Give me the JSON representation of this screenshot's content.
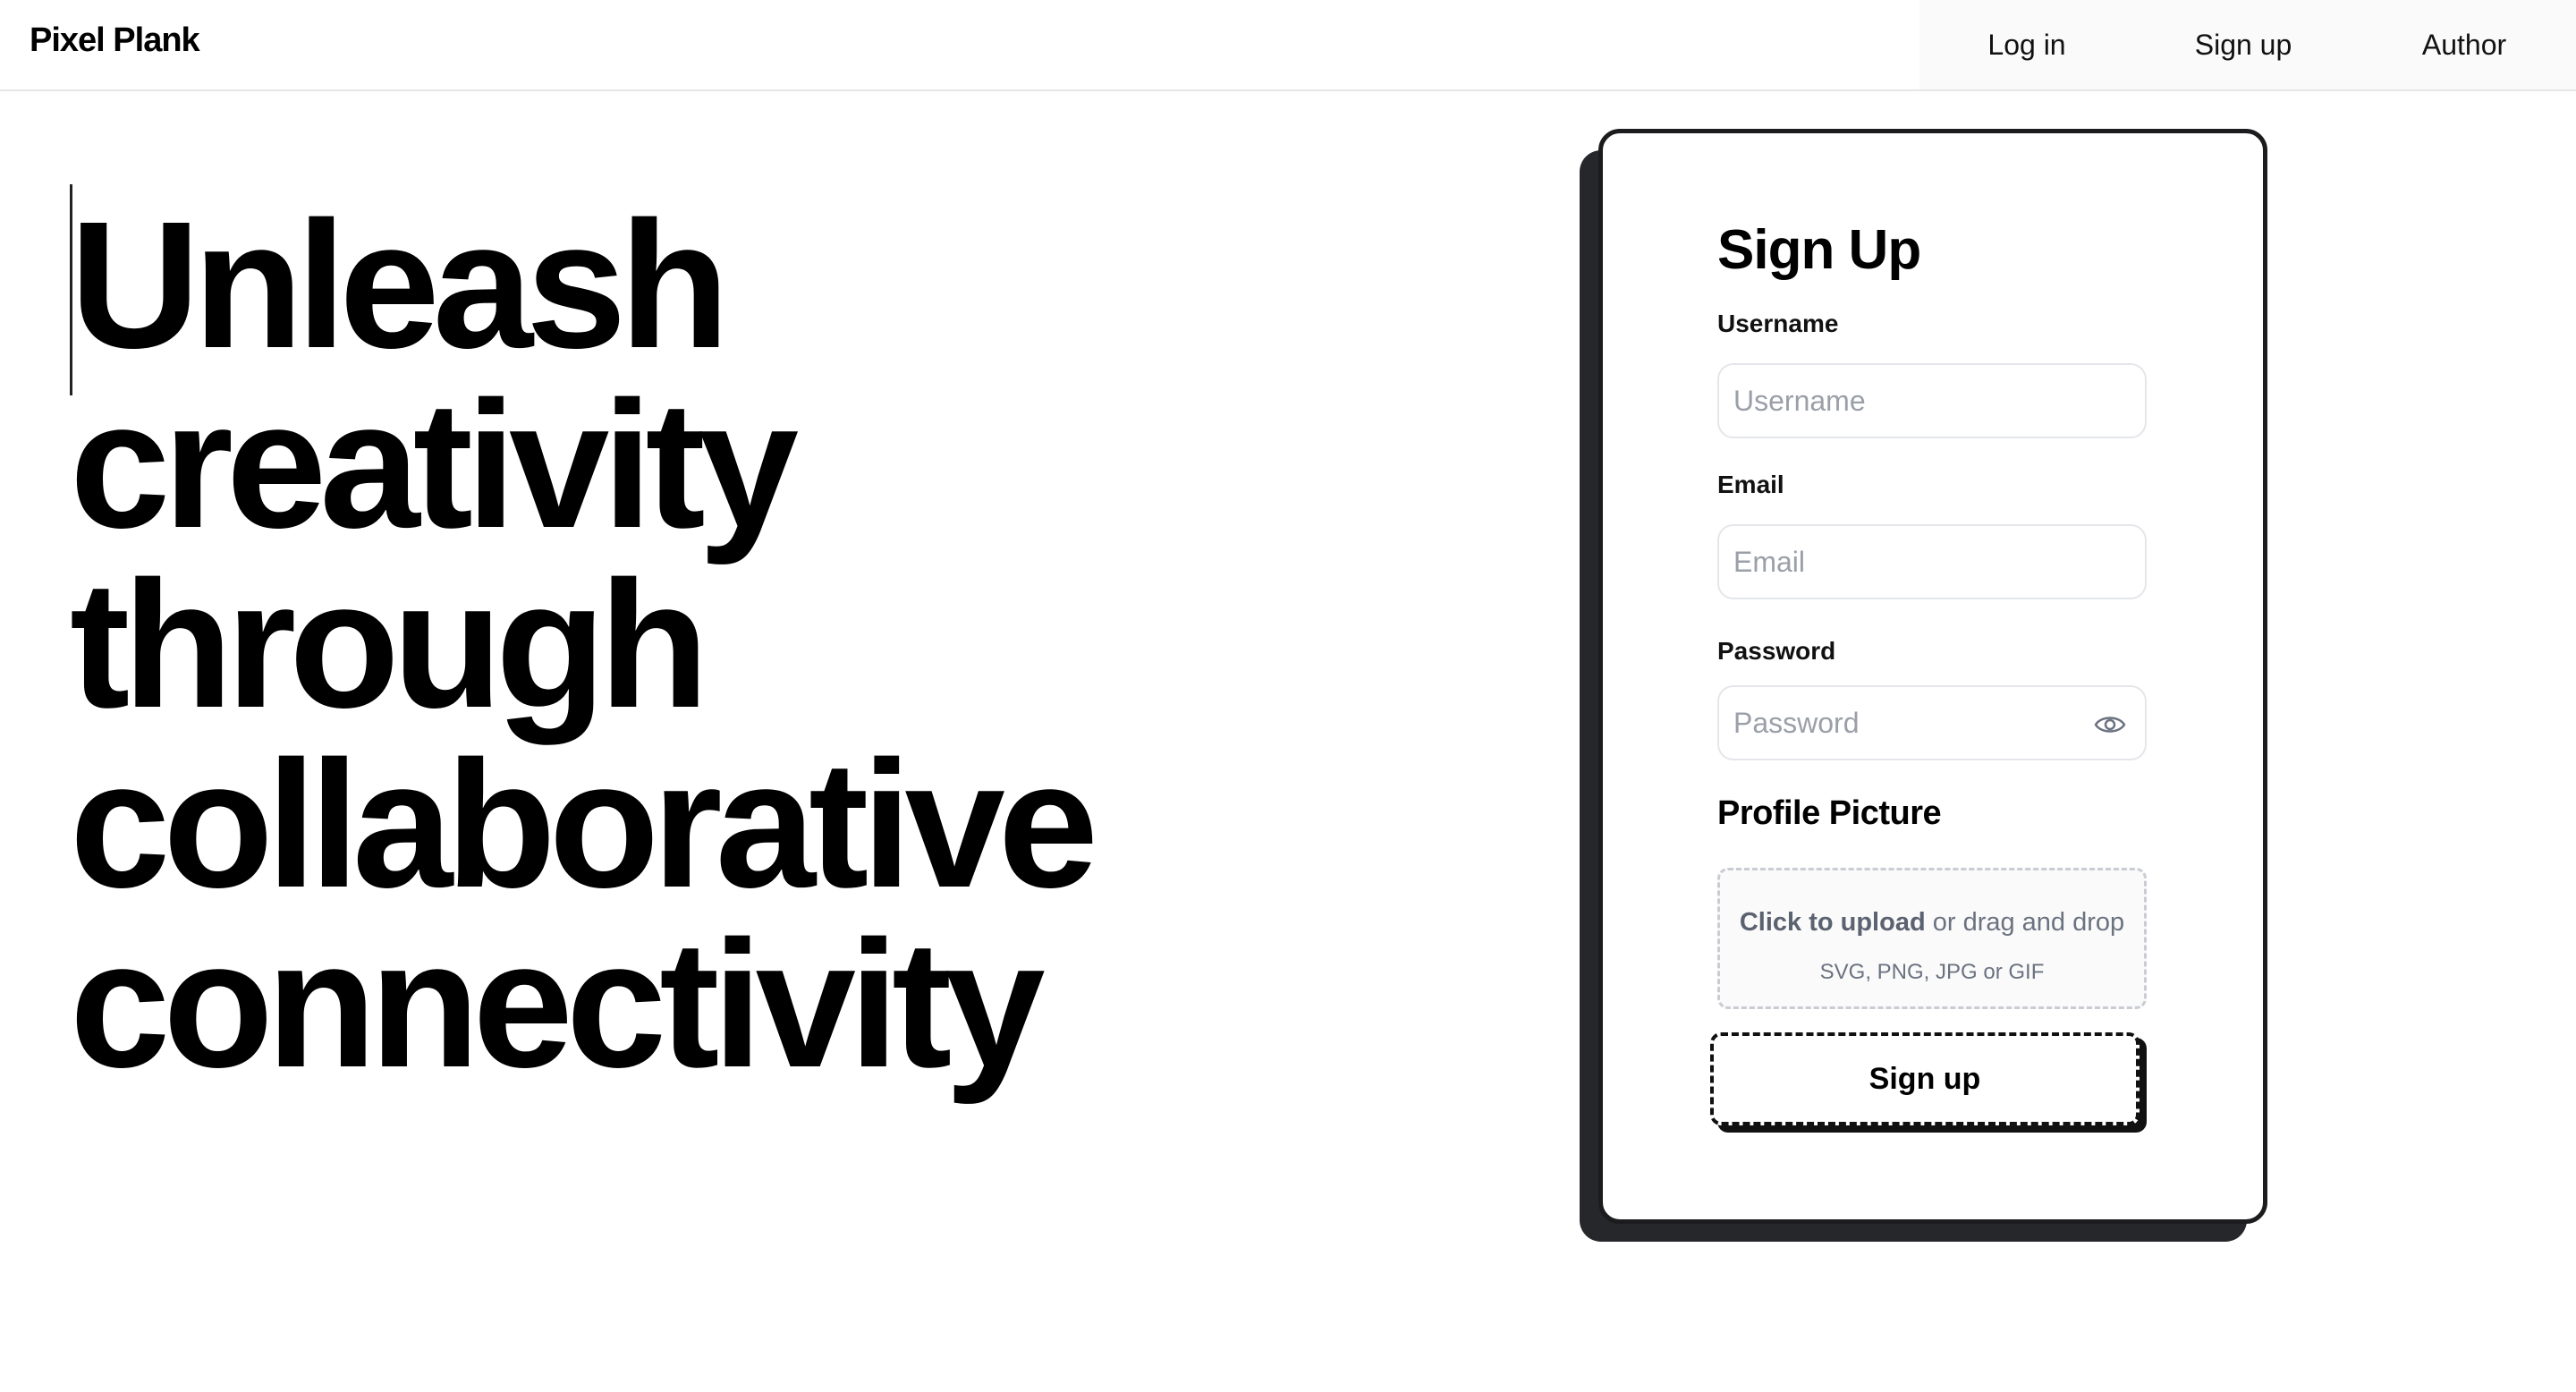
{
  "header": {
    "brand": "Pixel Plank",
    "nav": {
      "login": "Log in",
      "signup": "Sign up",
      "author": "Author"
    }
  },
  "hero": {
    "lines": [
      "Unleash",
      "creativity",
      "through",
      "collaborative",
      "connectivity"
    ]
  },
  "form": {
    "title": "Sign Up",
    "username": {
      "label": "Username",
      "placeholder": "Username",
      "value": ""
    },
    "email": {
      "label": "Email",
      "placeholder": "Email",
      "value": ""
    },
    "password": {
      "label": "Password",
      "placeholder": "Password",
      "value": "",
      "toggle_icon": "eye-icon"
    },
    "profile_picture": {
      "title": "Profile Picture",
      "upload_strong": "Click to upload",
      "upload_rest": " or drag and drop",
      "formats": "SVG, PNG, JPG or GIF"
    },
    "submit_label": "Sign up"
  },
  "colors": {
    "card_border": "#1c1c1e",
    "card_shadow": "#26272b",
    "placeholder": "#9a9fa8",
    "input_border": "#e4e6ea"
  }
}
